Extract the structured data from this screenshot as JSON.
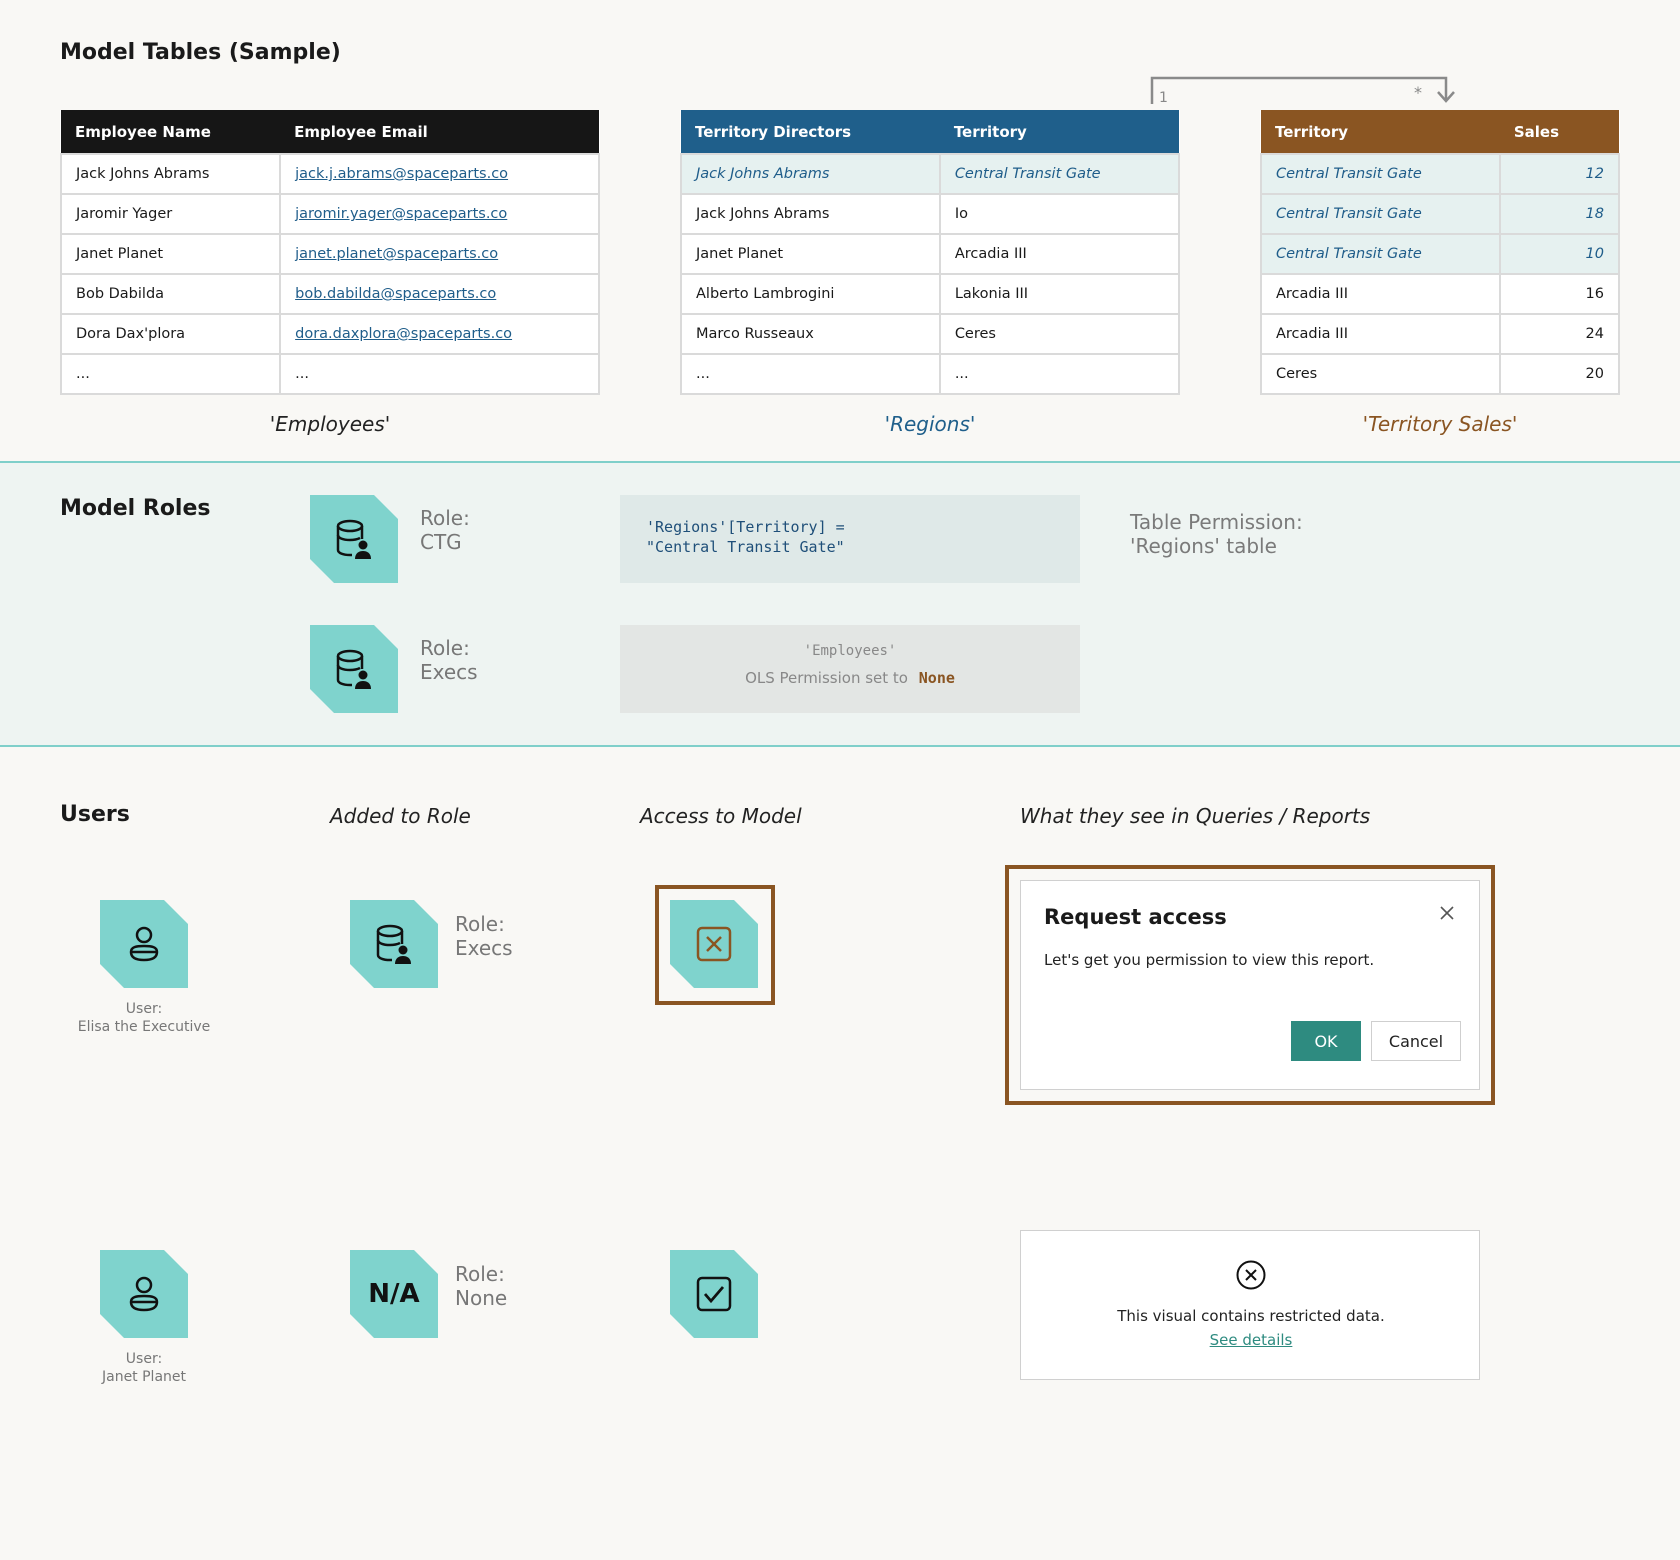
{
  "tables_section": {
    "title": "Model Tables (Sample)",
    "employees": {
      "caption": "'Employees'",
      "headers": [
        "Employee Name",
        "Employee Email"
      ],
      "rows": [
        [
          "Jack Johns Abrams",
          "jack.j.abrams@spaceparts.co"
        ],
        [
          "Jaromir Yager",
          "jaromir.yager@spaceparts.co"
        ],
        [
          "Janet Planet",
          "janet.planet@spaceparts.co"
        ],
        [
          "Bob Dabilda",
          "bob.dabilda@spaceparts.co"
        ],
        [
          "Dora Dax'plora",
          "dora.daxplora@spaceparts.co"
        ],
        [
          "...",
          "..."
        ]
      ]
    },
    "regions": {
      "caption": "'Regions'",
      "headers": [
        "Territory Directors",
        "Territory"
      ],
      "rows": [
        [
          "Jack Johns Abrams",
          "Central Transit Gate"
        ],
        [
          "Jack Johns Abrams",
          "Io"
        ],
        [
          "Janet Planet",
          "Arcadia III"
        ],
        [
          "Alberto Lambrogini",
          "Lakonia III"
        ],
        [
          "Marco Russeaux",
          "Ceres"
        ],
        [
          "...",
          "..."
        ]
      ]
    },
    "territory_sales": {
      "caption": "'Territory Sales'",
      "headers": [
        "Territory",
        "Sales"
      ],
      "rows": [
        [
          "Central Transit Gate",
          "12"
        ],
        [
          "Central Transit Gate",
          "18"
        ],
        [
          "Central Transit Gate",
          "10"
        ],
        [
          "Arcadia III",
          "16"
        ],
        [
          "Arcadia III",
          "24"
        ],
        [
          "Ceres",
          "20"
        ]
      ]
    },
    "relationship": {
      "from_cardinality": "1",
      "to_cardinality": "*"
    }
  },
  "roles_section": {
    "title": "Model Roles",
    "role_ctg": {
      "label_prefix": "Role:",
      "label_name": "CTG",
      "filter_line1": "'Regions'[Territory] =",
      "filter_line2": "\"Central Transit Gate\"",
      "permission_line1": "Table Permission:",
      "permission_line2": "'Regions' table"
    },
    "role_execs": {
      "label_prefix": "Role:",
      "label_name": "Execs",
      "ols_table": "'Employees'",
      "ols_text": "OLS Permission set to",
      "ols_value": "None"
    }
  },
  "users_section": {
    "title": "Users",
    "col_added": "Added to Role",
    "col_access": "Access to Model",
    "col_see": "What they see in Queries / Reports",
    "user1": {
      "caption_prefix": "User:",
      "caption_name": "Elisa the Executive",
      "role_prefix": "Role:",
      "role_name": "Execs"
    },
    "dialog": {
      "title": "Request access",
      "body": "Let's get you permission to view this report.",
      "ok": "OK",
      "cancel": "Cancel"
    },
    "user2": {
      "caption_prefix": "User:",
      "caption_name": "Janet Planet",
      "role_icon_text": "N/A",
      "role_prefix": "Role:",
      "role_name": "None"
    },
    "restricted": {
      "message": "This visual contains restricted data.",
      "link": "See details"
    }
  },
  "colors": {
    "teal_tile": "#7fd3cd",
    "employees_header": "#161616",
    "regions_header": "#1f5f8b",
    "sales_header": "#8a5522",
    "ok_button": "#2e8b80"
  }
}
